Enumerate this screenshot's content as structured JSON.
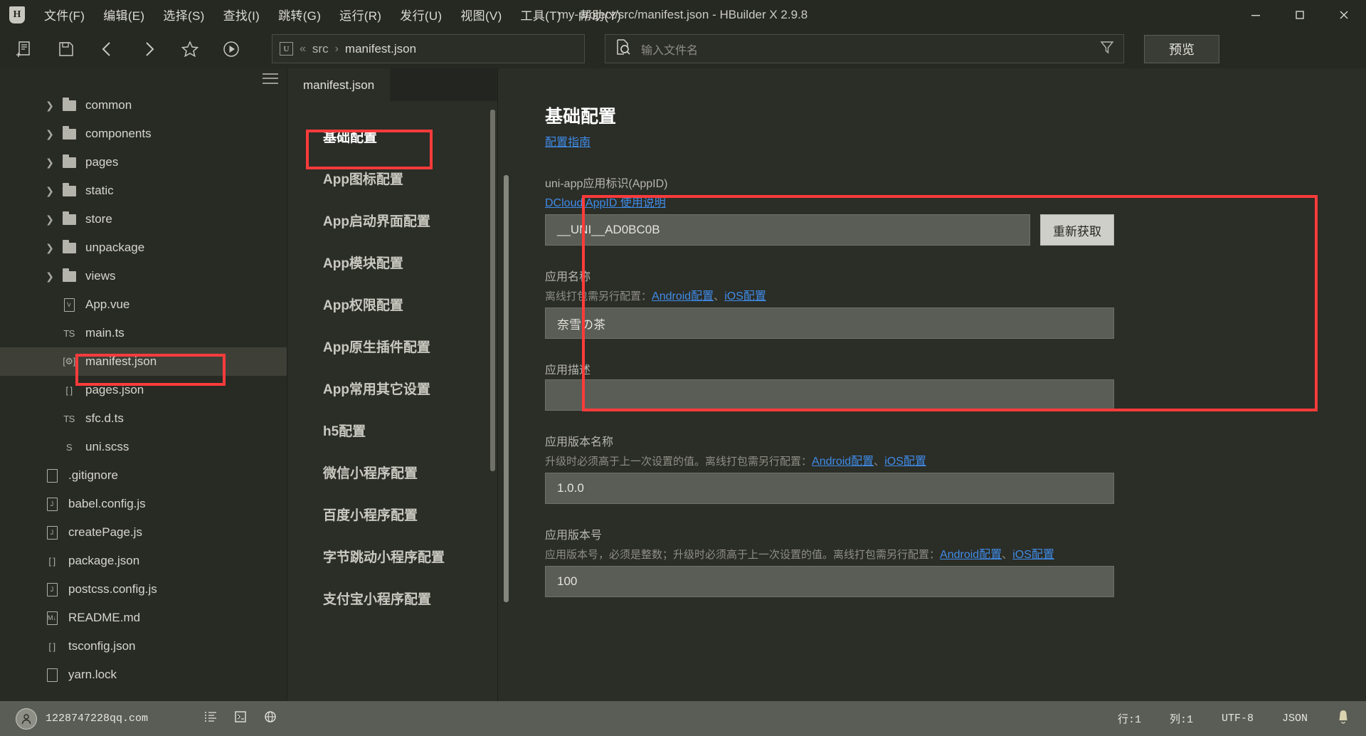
{
  "window": {
    "title": "my-project/src/manifest.json - HBuilder X 2.9.8",
    "logo": "H",
    "minimize_icon": "minimize-icon",
    "maximize_icon": "maximize-icon",
    "close_icon": "close-icon"
  },
  "menu": [
    {
      "label": "文件(F)",
      "name": "menu-file"
    },
    {
      "label": "编辑(E)",
      "name": "menu-edit"
    },
    {
      "label": "选择(S)",
      "name": "menu-select"
    },
    {
      "label": "查找(I)",
      "name": "menu-find"
    },
    {
      "label": "跳转(G)",
      "name": "menu-goto"
    },
    {
      "label": "运行(R)",
      "name": "menu-run"
    },
    {
      "label": "发行(U)",
      "name": "menu-publish"
    },
    {
      "label": "视图(V)",
      "name": "menu-view"
    },
    {
      "label": "工具(T)",
      "name": "menu-tools"
    },
    {
      "label": "帮助(Y)",
      "name": "menu-help"
    }
  ],
  "toolbar": {
    "icons": [
      "new-file-icon",
      "save-icon",
      "back-arrow-icon",
      "forward-arrow-icon",
      "star-icon",
      "run-icon"
    ],
    "breadcrumb": {
      "badge": "U",
      "sep1": "«",
      "folder": "src",
      "sep2": "›",
      "file": "manifest.json"
    },
    "search": {
      "icon": "file-search-icon",
      "placeholder": "输入文件名",
      "value": ""
    },
    "filter_icon": "filter-icon",
    "preview_label": "预览"
  },
  "sidebar": {
    "menu_icon": "hamburger-icon",
    "items": [
      {
        "label": "common",
        "type": "folder",
        "indent": 1,
        "expandable": true
      },
      {
        "label": "components",
        "type": "folder",
        "indent": 1,
        "expandable": true
      },
      {
        "label": "pages",
        "type": "folder",
        "indent": 1,
        "expandable": true
      },
      {
        "label": "static",
        "type": "folder",
        "indent": 1,
        "expandable": true
      },
      {
        "label": "store",
        "type": "folder",
        "indent": 1,
        "expandable": true
      },
      {
        "label": "unpackage",
        "type": "folder",
        "indent": 1,
        "expandable": true
      },
      {
        "label": "views",
        "type": "folder",
        "indent": 1,
        "expandable": true
      },
      {
        "label": "App.vue",
        "type": "vue",
        "icon_text": "V",
        "indent": 1,
        "expandable": false
      },
      {
        "label": "main.ts",
        "type": "ts",
        "icon_text": "TS",
        "indent": 1,
        "expandable": false
      },
      {
        "label": "manifest.json",
        "type": "manifest",
        "icon_text": "[⚙]",
        "indent": 1,
        "expandable": false,
        "selected": true
      },
      {
        "label": "pages.json",
        "type": "json",
        "icon_text": "[ ]",
        "indent": 1,
        "expandable": false
      },
      {
        "label": "sfc.d.ts",
        "type": "ts",
        "icon_text": "TS",
        "indent": 1,
        "expandable": false
      },
      {
        "label": "uni.scss",
        "type": "scss",
        "icon_text": "S",
        "indent": 1,
        "expandable": false
      },
      {
        "label": ".gitignore",
        "type": "file",
        "indent": 0,
        "expandable": false
      },
      {
        "label": "babel.config.js",
        "type": "js",
        "icon_text": "J",
        "indent": 0,
        "expandable": false
      },
      {
        "label": "createPage.js",
        "type": "js",
        "icon_text": "J",
        "indent": 0,
        "expandable": false
      },
      {
        "label": "package.json",
        "type": "json",
        "icon_text": "[ ]",
        "indent": 0,
        "expandable": false
      },
      {
        "label": "postcss.config.js",
        "type": "js",
        "icon_text": "J",
        "indent": 0,
        "expandable": false
      },
      {
        "label": "README.md",
        "type": "md",
        "icon_text": "M↓",
        "indent": 0,
        "expandable": false
      },
      {
        "label": "tsconfig.json",
        "type": "json",
        "icon_text": "[ ]",
        "indent": 0,
        "expandable": false
      },
      {
        "label": "yarn.lock",
        "type": "file",
        "indent": 0,
        "expandable": false
      }
    ]
  },
  "navpanel": {
    "tab_label": "manifest.json",
    "items": [
      {
        "label": "基础配置",
        "active": true
      },
      {
        "label": "App图标配置",
        "active": false
      },
      {
        "label": "App启动界面配置",
        "active": false
      },
      {
        "label": "App模块配置",
        "active": false
      },
      {
        "label": "App权限配置",
        "active": false
      },
      {
        "label": "App原生插件配置",
        "active": false
      },
      {
        "label": "App常用其它设置",
        "active": false
      },
      {
        "label": "h5配置",
        "active": false
      },
      {
        "label": "微信小程序配置",
        "active": false
      },
      {
        "label": "百度小程序配置",
        "active": false
      },
      {
        "label": "字节跳动小程序配置",
        "active": false
      },
      {
        "label": "支付宝小程序配置",
        "active": false
      }
    ]
  },
  "content": {
    "title": "基础配置",
    "guide_link": "配置指南",
    "appid": {
      "label": "uni-app应用标识(AppID)",
      "link": "DCloud AppID 使用说明",
      "value": "__UNI__AD0BC0B",
      "button": "重新获取"
    },
    "appname": {
      "label": "应用名称",
      "sub_prefix": "离线打包需另行配置：",
      "link_android": "Android配置",
      "link_sep": "、",
      "link_ios": "iOS配置",
      "value": "奈雪の茶"
    },
    "appdesc": {
      "label": "应用描述",
      "value": ""
    },
    "appversionname": {
      "label": "应用版本名称",
      "sub_prefix": "升级时必须高于上一次设置的值。离线打包需另行配置：",
      "link_android": "Android配置",
      "link_sep": "、",
      "link_ios": "iOS配置",
      "value": "1.0.0"
    },
    "appversioncode": {
      "label": "应用版本号",
      "sub_prefix": "应用版本号，必须是整数；升级时必须高于上一次设置的值。离线打包需另行配置：",
      "link_android": "Android配置",
      "link_sep": "、",
      "link_ios": "iOS配置",
      "value": "100"
    }
  },
  "statusbar": {
    "avatar_icon": "user-avatar-icon",
    "account": "1228747228qq.com",
    "icons": [
      "outline-list-icon",
      "terminal-icon",
      "globe-icon"
    ],
    "line": "行:1",
    "column": "列:1",
    "encoding": "UTF-8",
    "language": "JSON",
    "bell_icon": "bell-icon"
  },
  "annotations": {
    "color": "#fb3b3b"
  }
}
